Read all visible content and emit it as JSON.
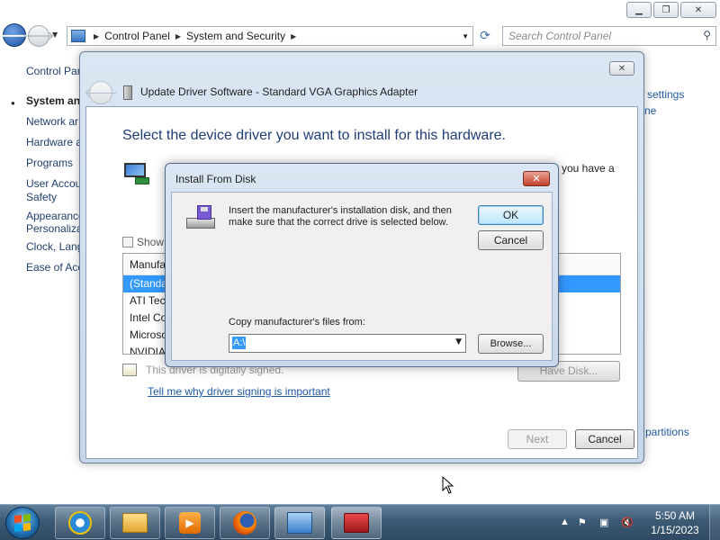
{
  "explorer": {
    "address": {
      "crumbs": [
        "Control Panel",
        "System and Security"
      ]
    },
    "search": {
      "placeholder": "Search Control Panel"
    },
    "left_pane": {
      "items": [
        "Control Par",
        "System and",
        "Network ar",
        "Hardware a",
        "Programs",
        "User Accou",
        "Safety",
        "Appearance",
        "Personaliza",
        "Clock, Lang",
        "Ease of Acc"
      ]
    },
    "right_links": {
      "settings": "settings",
      "ne": "ne",
      "partitions": "partitions"
    }
  },
  "update_driver": {
    "title": "Update Driver Software - Standard VGA Graphics Adapter",
    "heading": "Select the device driver you want to install for this hardware.",
    "partial_text": "you have a",
    "show_compatible": "Show",
    "list_header": "Manufa",
    "manufacturers": [
      "(Standa",
      "ATI Tec",
      "Intel Co",
      "Microso",
      "NVIDIA"
    ],
    "signed_text": "This driver is digitally signed.",
    "signing_link": "Tell me why driver signing is important",
    "have_disk": "Have Disk...",
    "next": "Next",
    "cancel": "Cancel"
  },
  "install_from_disk": {
    "title": "Install From Disk",
    "message": "Insert the manufacturer's installation disk, and then make sure that the correct drive is selected below.",
    "ok": "OK",
    "cancel": "Cancel",
    "copy_label": "Copy manufacturer's files from:",
    "path_value": "A:\\",
    "browse": "Browse..."
  },
  "taskbar": {
    "apps": [
      "internet-explorer",
      "windows-explorer",
      "media-player",
      "firefox",
      "control-panel",
      "toolbox"
    ],
    "time": "5:50 AM",
    "date": "1/15/2023"
  }
}
